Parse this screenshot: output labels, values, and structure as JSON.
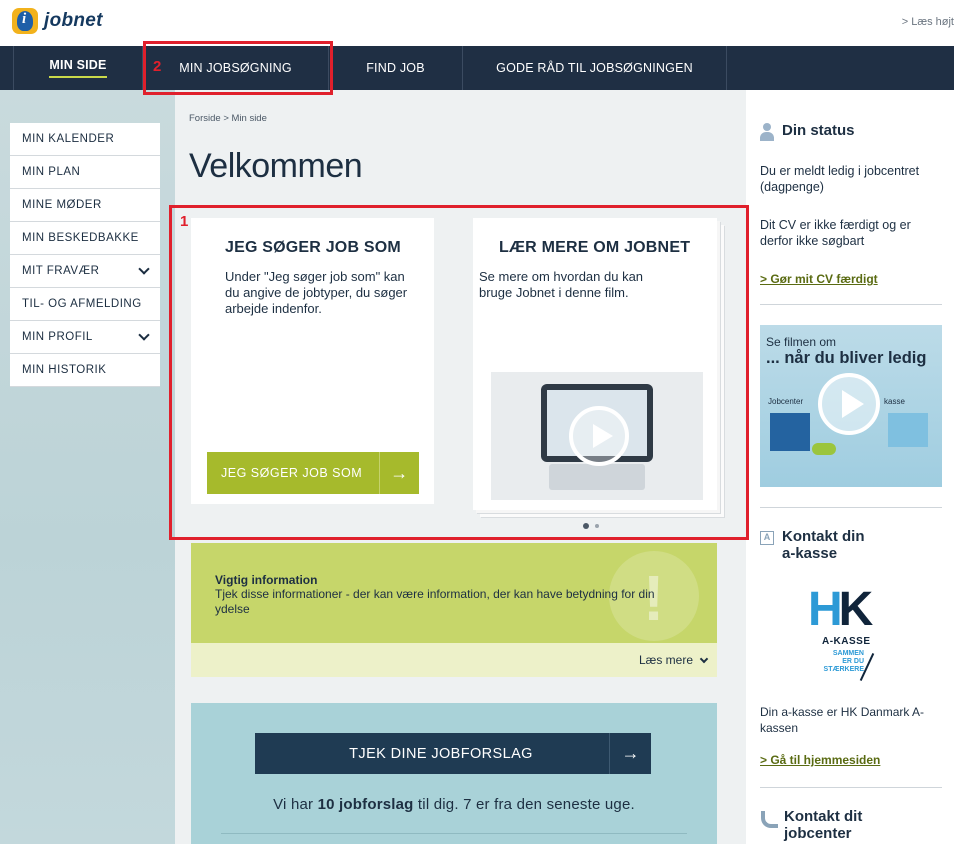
{
  "header": {
    "logo_text": "jobnet",
    "logo_letter": "i",
    "read_aloud": "> Læs højt"
  },
  "nav": {
    "items": [
      {
        "label": "MIN SIDE"
      },
      {
        "label": "MIN JOBSØGNING"
      },
      {
        "label": "FIND JOB"
      },
      {
        "label": "GODE RÅD TIL JOBSØGNINGEN"
      }
    ]
  },
  "sidebar": {
    "items": [
      {
        "label": "MIN KALENDER"
      },
      {
        "label": "MIN PLAN"
      },
      {
        "label": "MINE MØDER"
      },
      {
        "label": "MIN BESKEDBAKKE"
      },
      {
        "label": "MIT FRAVÆR"
      },
      {
        "label": "TIL- OG AFMELDING"
      },
      {
        "label": "MIN PROFIL"
      },
      {
        "label": "MIN HISTORIK"
      }
    ]
  },
  "main": {
    "breadcrumb": "Forside > Min side",
    "title": "Velkommen",
    "card1": {
      "title": "JEG SØGER JOB SOM",
      "text": "Under \"Jeg søger job som\" kan du angive de jobtyper, du søger arbejde indenfor.",
      "button": "JEG SØGER JOB SOM",
      "arrow": "→"
    },
    "card2": {
      "title": "LÆR MERE OM JOBNET",
      "text": "Se mere om hvordan du kan bruge Jobnet i denne film."
    },
    "info": {
      "title": "Vigtig information",
      "text": "Tjek disse informationer - der kan være information, der kan have betydning for din ydelse",
      "mark": "!",
      "more": "Læs mere"
    },
    "jobs": {
      "button": "TJEK DINE JOBFORSLAG",
      "arrow": "→",
      "text_prefix": "Vi har ",
      "text_bold": "10 jobforslag",
      "text_suffix": " til dig. 7 er fra den seneste uge."
    }
  },
  "right": {
    "status": {
      "title": "Din status",
      "text1": "Du er meldt ledig i jobcentret (dagpenge)",
      "text2": "Dit CV er ikke færdigt og er derfor ikke søgbart",
      "link": "> Gør mit CV færdigt"
    },
    "video": {
      "line1": "Se filmen om",
      "line2": "... når du bliver ledig",
      "label_left": "Jobcenter",
      "label_right": "kasse"
    },
    "akasse": {
      "title_line1": "Kontakt din",
      "title_line2": "a-kasse",
      "icon_letter": "A",
      "logo_h": "H",
      "logo_k": "K",
      "logo_sub": "A-KASSE",
      "logo_tag1": "SAMMEN",
      "logo_tag2": "ER DU",
      "logo_tag3": "STÆRKERE",
      "text": "Din a-kasse er HK Danmark A-kassen",
      "link": "> Gå til hjemmesiden"
    },
    "jobcenter": {
      "title_line1": "Kontakt dit",
      "title_line2": "jobcenter"
    }
  },
  "annotations": {
    "box1_number": "1",
    "box2_number": "2",
    "color": "#e0202c"
  }
}
